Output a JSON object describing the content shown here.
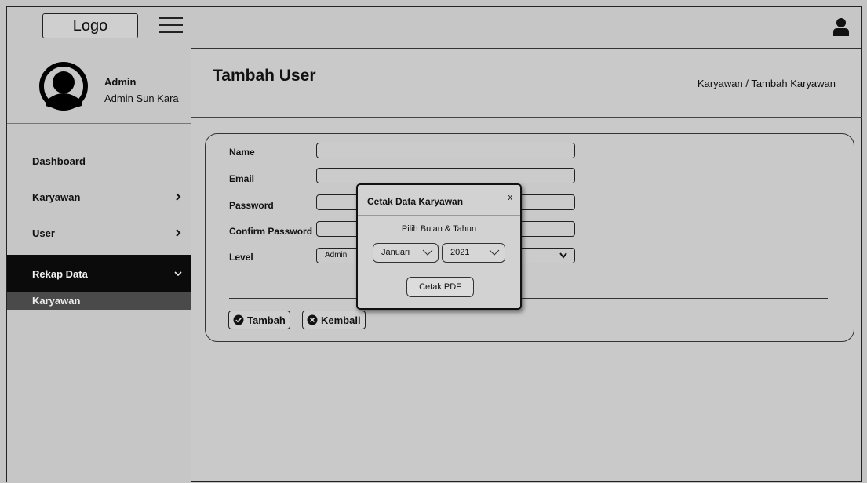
{
  "header": {
    "logo_label": "Logo"
  },
  "profile": {
    "name": "Admin",
    "role": "Admin Sun Kara"
  },
  "sidebar": {
    "items": [
      {
        "label": "Dashboard"
      },
      {
        "label": "Karyawan"
      },
      {
        "label": "User"
      },
      {
        "label": "Rekap Data"
      }
    ],
    "sub_item": "Karyawan"
  },
  "main": {
    "title": "Tambah User",
    "breadcrumb": "Karyawan / Tambah Karyawan",
    "form": {
      "name_label": "Name",
      "email_label": "Email",
      "password_label": "Password",
      "confirm_label": "Confirm Password",
      "level_label": "Level",
      "level_value": "Admin"
    },
    "buttons": {
      "tambah": "Tambah",
      "kembali": "Kembali"
    }
  },
  "modal": {
    "title": "Cetak Data Karyawan",
    "close": "x",
    "subtitle": "Pilih Bulan & Tahun",
    "month": "Januari",
    "year": "2021",
    "print_button": "Cetak PDF"
  }
}
